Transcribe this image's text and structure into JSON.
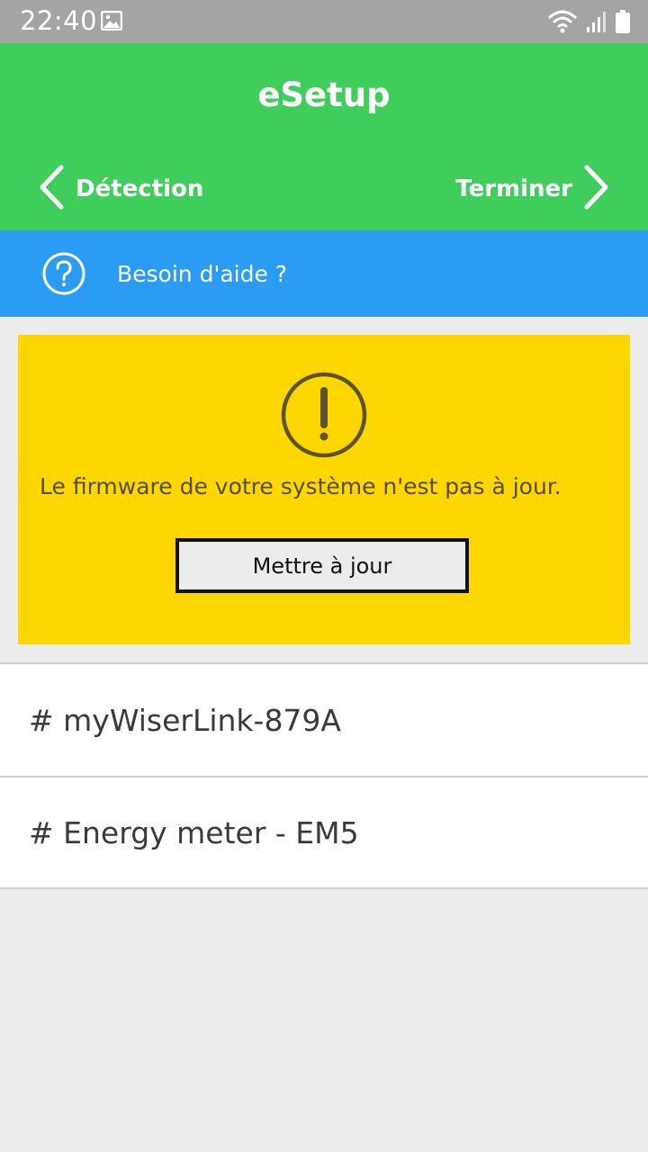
{
  "status_bar": {
    "time": "22:40",
    "icons": [
      "image-icon",
      "wifi-icon",
      "signal-icon",
      "battery-icon"
    ]
  },
  "header": {
    "title": "eSetup",
    "back_label": "Détection",
    "next_label": "Terminer",
    "background_color": "#3fcd5b"
  },
  "help": {
    "label": "Besoin d'aide ?",
    "icon": "question-circle-icon",
    "background_color": "#2a9cf3"
  },
  "alert": {
    "icon": "warning-circle-icon",
    "message": "Le firmware de votre système n'est pas à jour.",
    "button_label": "Mettre à jour",
    "background_color": "#fed600"
  },
  "devices": [
    {
      "label": "# myWiserLink-879A"
    },
    {
      "label": "# Energy meter - EM5"
    }
  ]
}
